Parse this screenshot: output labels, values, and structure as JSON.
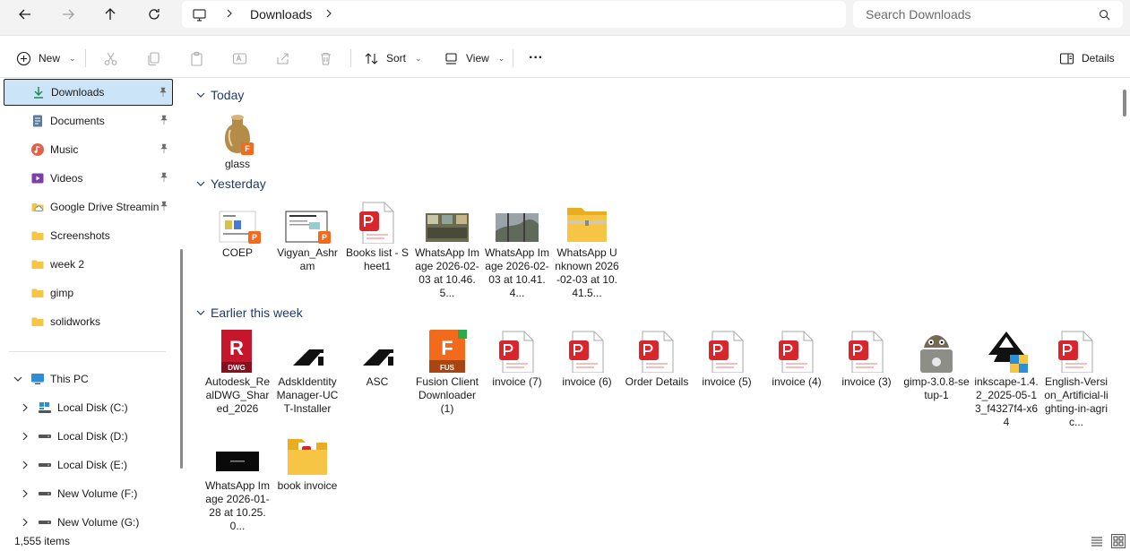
{
  "address": {
    "crumb": "Downloads",
    "search_placeholder": "Search Downloads"
  },
  "toolbar": {
    "new_label": "New",
    "sort_label": "Sort",
    "view_label": "View",
    "more_label": "···",
    "details_label": "Details"
  },
  "sidebar": {
    "quick": [
      {
        "label": "Downloads",
        "icon": "download-icon",
        "pinned": true
      },
      {
        "label": "Documents",
        "icon": "document-icon",
        "pinned": true
      },
      {
        "label": "Music",
        "icon": "music-icon",
        "pinned": true
      },
      {
        "label": "Videos",
        "icon": "video-icon",
        "pinned": true
      },
      {
        "label": "Google Drive Streaming",
        "icon": "cloud-folder-icon",
        "pinned": true
      },
      {
        "label": "Screenshots",
        "icon": "folder-icon",
        "pinned": false
      },
      {
        "label": "week 2",
        "icon": "folder-icon",
        "pinned": false
      },
      {
        "label": "gimp",
        "icon": "folder-icon",
        "pinned": false
      },
      {
        "label": "solidworks",
        "icon": "folder-icon",
        "pinned": false
      }
    ],
    "this_pc": "This PC",
    "drives": [
      {
        "label": "Local Disk (C:)"
      },
      {
        "label": "Local Disk (D:)"
      },
      {
        "label": "Local Disk (E:)"
      },
      {
        "label": "New Volume (F:)"
      },
      {
        "label": "New Volume (G:)"
      }
    ]
  },
  "groups": {
    "today": "Today",
    "yesterday": "Yesterday",
    "earlier": "Earlier this week"
  },
  "files": {
    "today": [
      {
        "name": "glass",
        "icon": "fusion-model-icon"
      }
    ],
    "yesterday": [
      {
        "name": "COEP",
        "icon": "powerpoint-image-icon"
      },
      {
        "name": "Vigyan_Ashram",
        "icon": "powerpoint-image-icon"
      },
      {
        "name": "Books list - Sheet1",
        "icon": "pdf-icon"
      },
      {
        "name": "WhatsApp Image 2026-02-03 at 10.46.5...",
        "icon": "photo-thumbnail"
      },
      {
        "name": "WhatsApp Image 2026-02-03 at 10.41.4...",
        "icon": "photo-thumbnail"
      },
      {
        "name": "WhatsApp Unknown 2026-02-03 at 10.41.5...",
        "icon": "zip-folder-icon"
      }
    ],
    "earlier": [
      {
        "name": "Autodesk_RealDWG_Shared_2026",
        "icon": "dwg-icon"
      },
      {
        "name": "AdskIdentityManager-UCT-Installer",
        "icon": "autodesk-icon"
      },
      {
        "name": "ASC",
        "icon": "autodesk-icon"
      },
      {
        "name": "Fusion Client Downloader (1)",
        "icon": "fusion-app-icon"
      },
      {
        "name": "invoice (7)",
        "icon": "pdf-icon"
      },
      {
        "name": "invoice (6)",
        "icon": "pdf-icon"
      },
      {
        "name": "Order Details",
        "icon": "pdf-icon"
      },
      {
        "name": "invoice (5)",
        "icon": "pdf-icon"
      },
      {
        "name": "invoice (4)",
        "icon": "pdf-icon"
      },
      {
        "name": "invoice (3)",
        "icon": "pdf-icon"
      },
      {
        "name": "gimp-3.0.8-setup-1",
        "icon": "gimp-icon"
      },
      {
        "name": "inkscape-1.4.2_2025-05-13_f4327f4-x64",
        "icon": "inkscape-icon"
      },
      {
        "name": "English-Version_Artificial-lighting-in-agric...",
        "icon": "pdf-icon"
      },
      {
        "name": "WhatsApp Image 2026-01-28 at 10.25.0...",
        "icon": "photo-thumbnail-dark"
      },
      {
        "name": "book invoice",
        "icon": "pdf-folder-icon"
      }
    ]
  },
  "status": {
    "count": "1,555 items"
  },
  "colors": {
    "selection": "#cce4f7",
    "group_header": "#1f3a6e",
    "pdf_red": "#d9262c",
    "folder_yellow": "#f6c544",
    "fusion_orange": "#f26b1d"
  }
}
